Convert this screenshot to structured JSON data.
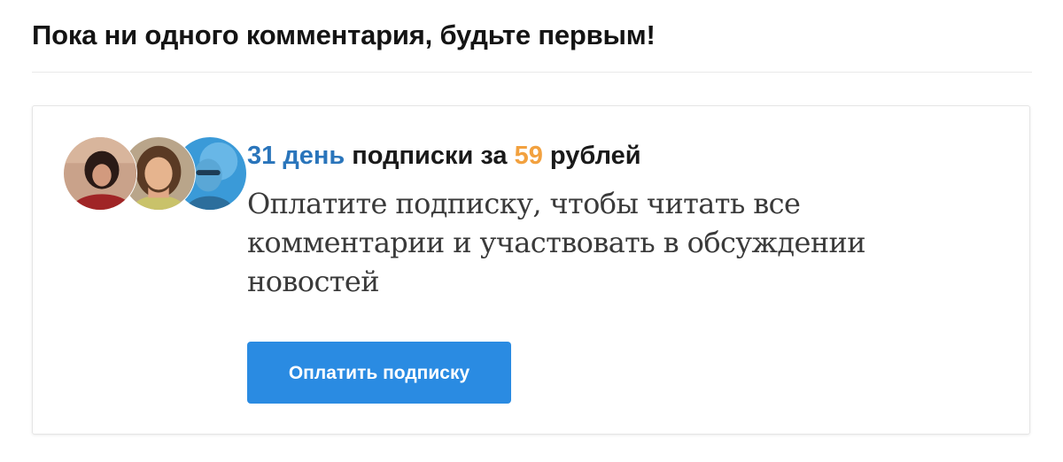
{
  "comments": {
    "empty_message": "Пока ни одного комментария, будьте первым!"
  },
  "promo": {
    "title_days": "31 день",
    "title_middle": " подписки за ",
    "title_price": "59",
    "title_suffix": " рублей",
    "description": "Оплатите подписку, чтобы читать все комментарии и участвовать в обсуждении новостей",
    "button_label": "Оплатить подписку",
    "avatars": [
      "user-avatar",
      "user-avatar",
      "user-avatar"
    ]
  },
  "colors": {
    "accent_blue": "#2a75bb",
    "price_orange": "#f2a13f",
    "button_blue": "#2a8be2"
  }
}
